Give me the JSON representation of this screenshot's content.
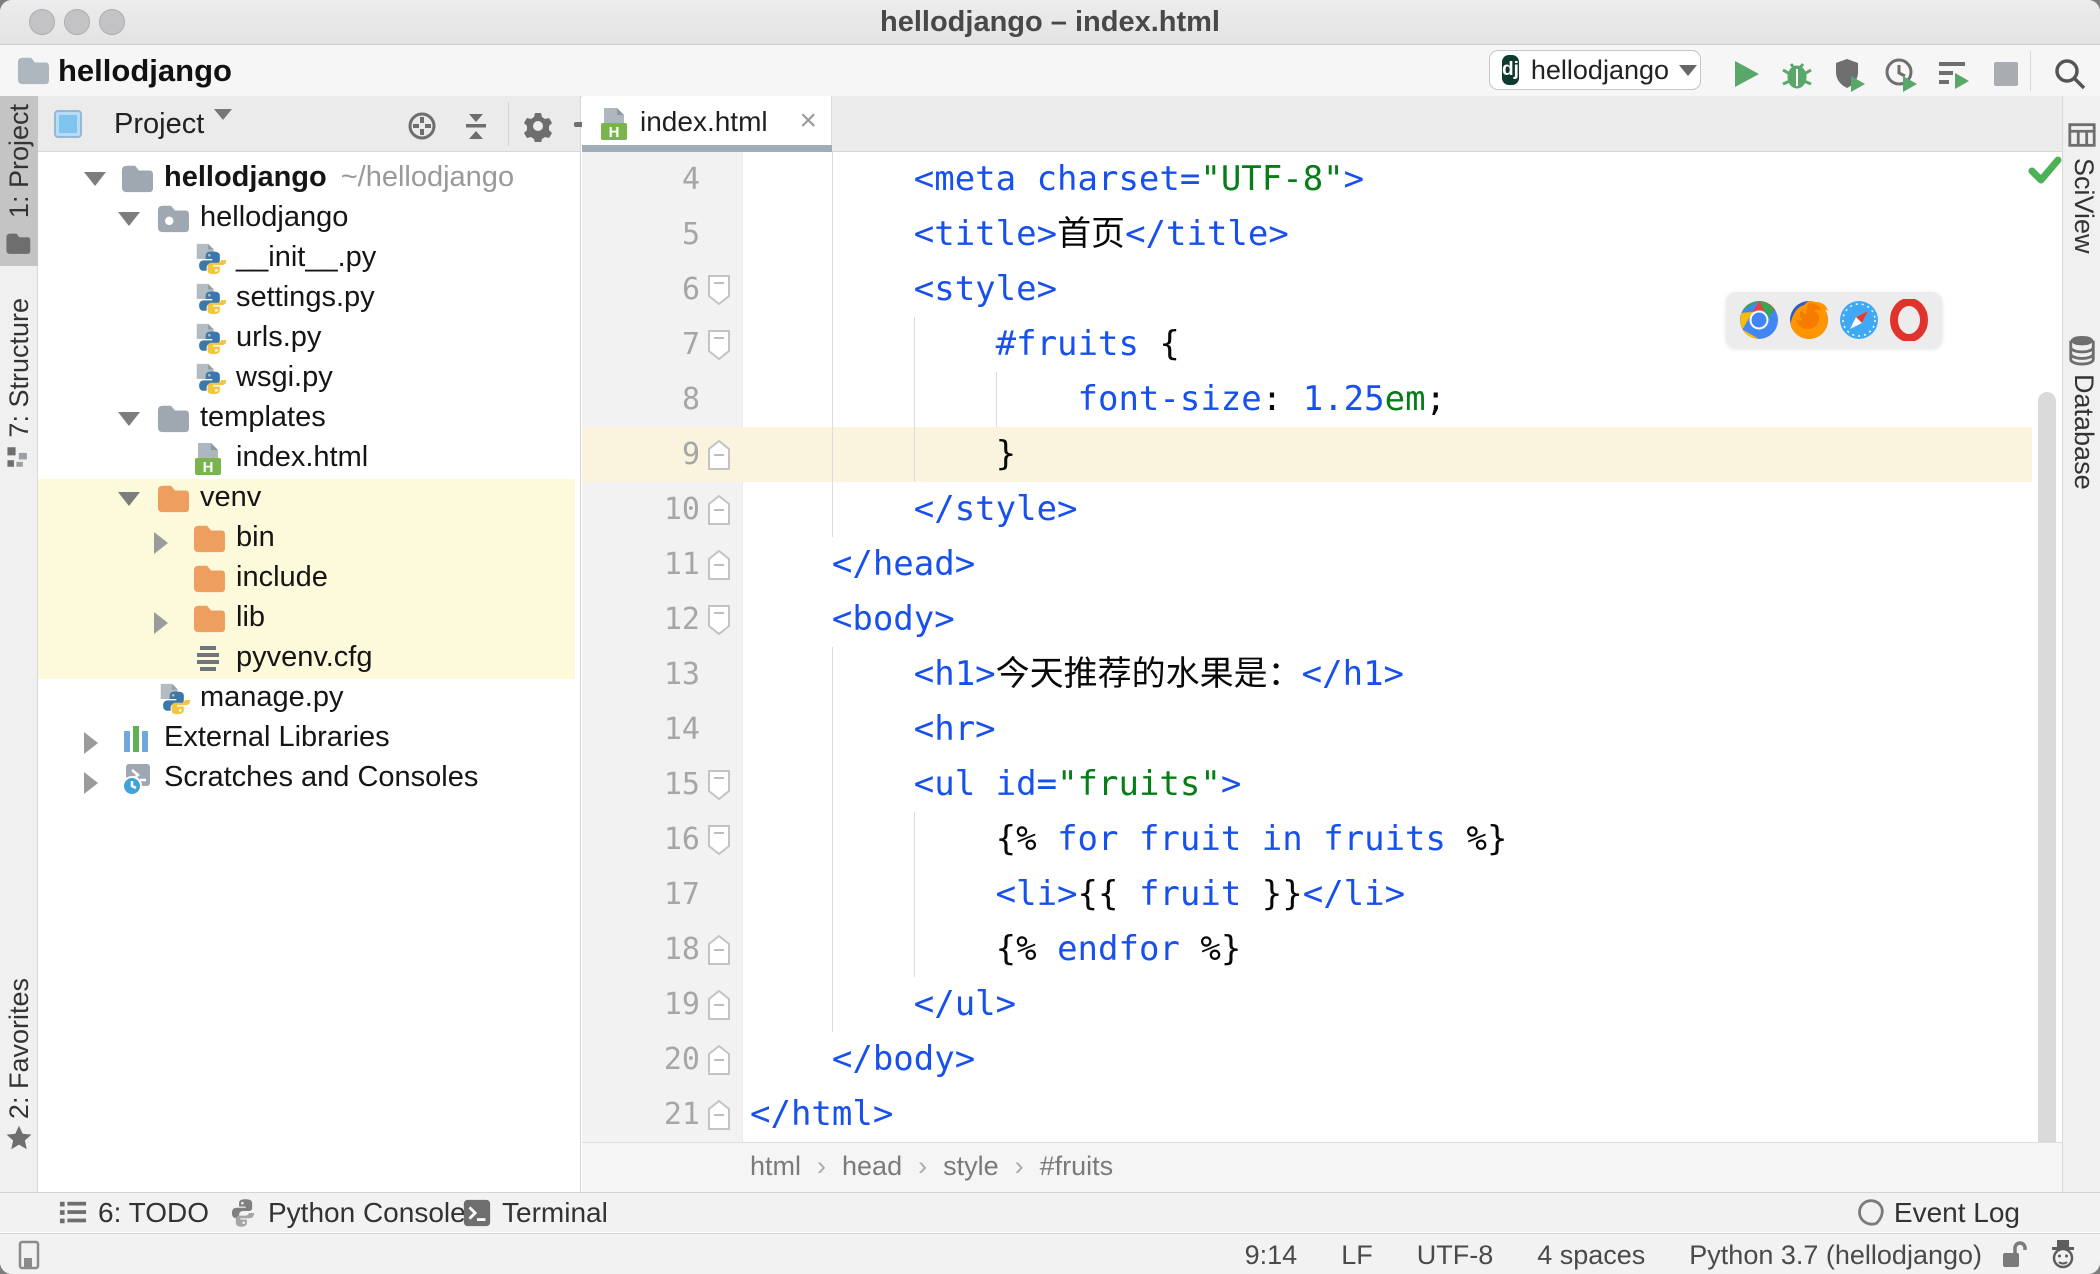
{
  "window": {
    "title": "hellodjango – index.html"
  },
  "toolbar": {
    "project_breadcrumb": "hellodjango",
    "run_config": "hellodjango",
    "icons": [
      "folder-icon",
      "run-icon",
      "debug-icon",
      "coverage-shield-icon",
      "profiler-clock-icon",
      "multirun-icon",
      "stop-icon",
      "search-icon"
    ]
  },
  "left_strip": {
    "items": [
      {
        "label": "1: Project",
        "icon": "project-tool-icon",
        "active": true
      },
      {
        "label": "7: Structure",
        "icon": "structure-tool-icon",
        "active": false
      },
      {
        "label": "2: Favorites",
        "icon": "favorites-star-icon",
        "active": false
      }
    ]
  },
  "right_strip": {
    "items": [
      {
        "label": "SciView",
        "icon": "sciview-icon"
      },
      {
        "label": "Database",
        "icon": "database-icon"
      }
    ]
  },
  "project_panel": {
    "title": "Project",
    "header_icons": [
      "locate-icon",
      "collapse-all-icon",
      "gear-icon",
      "minimize-icon"
    ],
    "tree": [
      {
        "label": "hellodjango",
        "path": "~/hellodjango",
        "icon": "folder",
        "level": 0,
        "arrow": "down",
        "bold": true,
        "highlight": false
      },
      {
        "label": "hellodjango",
        "icon": "package-folder",
        "level": 1,
        "arrow": "down",
        "highlight": false
      },
      {
        "label": "__init__.py",
        "icon": "python-file",
        "level": 2,
        "highlight": false
      },
      {
        "label": "settings.py",
        "icon": "python-file",
        "level": 2,
        "highlight": false
      },
      {
        "label": "urls.py",
        "icon": "python-file",
        "level": 2,
        "highlight": false
      },
      {
        "label": "wsgi.py",
        "icon": "python-file",
        "level": 2,
        "highlight": false
      },
      {
        "label": "templates",
        "icon": "folder",
        "level": 1,
        "arrow": "down",
        "highlight": false
      },
      {
        "label": "index.html",
        "icon": "html-file",
        "level": 2,
        "highlight": false
      },
      {
        "label": "venv",
        "icon": "excluded-folder",
        "level": 1,
        "arrow": "down",
        "highlight": true
      },
      {
        "label": "bin",
        "icon": "excluded-folder",
        "level": 2,
        "arrow": "right",
        "highlight": true
      },
      {
        "label": "include",
        "icon": "excluded-folder",
        "level": 2,
        "highlight": true
      },
      {
        "label": "lib",
        "icon": "excluded-folder",
        "level": 2,
        "arrow": "right",
        "highlight": true
      },
      {
        "label": "pyvenv.cfg",
        "icon": "config-file",
        "level": 2,
        "highlight": true
      },
      {
        "label": "manage.py",
        "icon": "python-file",
        "level": 1,
        "highlight": false
      },
      {
        "label": "External Libraries",
        "icon": "external-libraries",
        "level": 0,
        "arrow": "right",
        "highlight": false
      },
      {
        "label": "Scratches and Consoles",
        "icon": "scratches",
        "level": 0,
        "arrow": "right",
        "highlight": false
      }
    ]
  },
  "editor": {
    "tab": {
      "label": "index.html",
      "icon": "html-file",
      "close": "×"
    },
    "caret_line": 9,
    "lines": [
      {
        "n": 4,
        "indent": 8,
        "fold": null,
        "segs": [
          [
            "b",
            "<meta charset="
          ],
          [
            "g",
            "\"UTF-8\""
          ],
          [
            "b",
            ">"
          ]
        ]
      },
      {
        "n": 5,
        "indent": 8,
        "fold": null,
        "segs": [
          [
            "b",
            "<title>"
          ],
          [
            "k",
            "首页"
          ],
          [
            "b",
            "</title>"
          ]
        ]
      },
      {
        "n": 6,
        "indent": 8,
        "fold": "down",
        "segs": [
          [
            "b",
            "<style>"
          ]
        ]
      },
      {
        "n": 7,
        "indent": 12,
        "fold": "down",
        "segs": [
          [
            "b",
            "#fruits"
          ],
          [
            "k",
            " {"
          ]
        ]
      },
      {
        "n": 8,
        "indent": 16,
        "fold": null,
        "segs": [
          [
            "b",
            "font-size"
          ],
          [
            "k",
            ": "
          ],
          [
            "b",
            "1.25"
          ],
          [
            "g",
            "em"
          ],
          [
            "k",
            ";"
          ]
        ]
      },
      {
        "n": 9,
        "indent": 12,
        "fold": "up",
        "segs": [
          [
            "k",
            "}"
          ]
        ]
      },
      {
        "n": 10,
        "indent": 8,
        "fold": "up",
        "segs": [
          [
            "b",
            "</style>"
          ]
        ]
      },
      {
        "n": 11,
        "indent": 4,
        "fold": "up",
        "segs": [
          [
            "b",
            "</head>"
          ]
        ]
      },
      {
        "n": 12,
        "indent": 4,
        "fold": "down",
        "segs": [
          [
            "b",
            "<body>"
          ]
        ]
      },
      {
        "n": 13,
        "indent": 8,
        "fold": null,
        "segs": [
          [
            "b",
            "<h1>"
          ],
          [
            "k",
            "今天推荐的水果是："
          ],
          [
            "b",
            "</h1>"
          ]
        ]
      },
      {
        "n": 14,
        "indent": 8,
        "fold": null,
        "segs": [
          [
            "b",
            "<hr>"
          ]
        ]
      },
      {
        "n": 15,
        "indent": 8,
        "fold": "down",
        "segs": [
          [
            "b",
            "<ul id="
          ],
          [
            "g",
            "\"fruits\""
          ],
          [
            "b",
            ">"
          ]
        ]
      },
      {
        "n": 16,
        "indent": 12,
        "fold": "down",
        "segs": [
          [
            "k",
            "{% "
          ],
          [
            "b",
            "for fruit in fruits"
          ],
          [
            "k",
            " %}"
          ]
        ]
      },
      {
        "n": 17,
        "indent": 12,
        "fold": null,
        "segs": [
          [
            "b",
            "<li>"
          ],
          [
            "k",
            "{{ "
          ],
          [
            "b",
            "fruit"
          ],
          [
            "k",
            " }}"
          ],
          [
            "b",
            "</li>"
          ]
        ]
      },
      {
        "n": 18,
        "indent": 12,
        "fold": "up",
        "segs": [
          [
            "k",
            "{% "
          ],
          [
            "b",
            "endfor"
          ],
          [
            "k",
            " %}"
          ]
        ]
      },
      {
        "n": 19,
        "indent": 8,
        "fold": "up",
        "segs": [
          [
            "b",
            "</ul>"
          ]
        ]
      },
      {
        "n": 20,
        "indent": 4,
        "fold": "up",
        "segs": [
          [
            "b",
            "</body>"
          ]
        ]
      },
      {
        "n": 21,
        "indent": 0,
        "fold": "up",
        "segs": [
          [
            "b",
            "</html>"
          ]
        ]
      }
    ],
    "guides": [
      {
        "col": 4,
        "from": 4,
        "to": 11
      },
      {
        "col": 4,
        "from": 13,
        "to": 20
      },
      {
        "col": 8,
        "from": 7,
        "to": 10
      },
      {
        "col": 8,
        "from": 16,
        "to": 19
      },
      {
        "col": 12,
        "from": 8,
        "to": 9
      }
    ],
    "breadcrumbs": [
      "html",
      "head",
      "style",
      "#fruits"
    ],
    "inspection_status_icon": "check-icon"
  },
  "browser_popup": {
    "browsers": [
      "chrome",
      "firefox",
      "safari",
      "opera"
    ]
  },
  "bottom_bar": {
    "items": [
      {
        "label": "6: TODO",
        "icon": "todo-list-icon"
      },
      {
        "label": "Python Console",
        "icon": "python-console-icon"
      },
      {
        "label": "Terminal",
        "icon": "terminal-icon"
      }
    ],
    "event_log": {
      "label": "Event Log",
      "icon": "event-log-icon"
    }
  },
  "status_bar": {
    "items": [
      "9:14",
      "LF",
      "UTF-8",
      "4 spaces",
      "Python 3.7 (hellodjango)"
    ],
    "icons": [
      "toolwindow-switcher-icon",
      "unlocked-icon",
      "hector-inspector-icon"
    ]
  },
  "colors": {
    "code_blue": "#1750EB",
    "code_green": "#067D17",
    "code_black": "#080808",
    "caret_line_bg": "#FAF4DE",
    "tree_highlight_bg": "#FDFADB",
    "run_green": "#59A869",
    "excluded_folder_orange": "#EE9E5E",
    "folder_gray_blue": "#9FA8B0",
    "tab_underline": "#A2ADB8"
  }
}
